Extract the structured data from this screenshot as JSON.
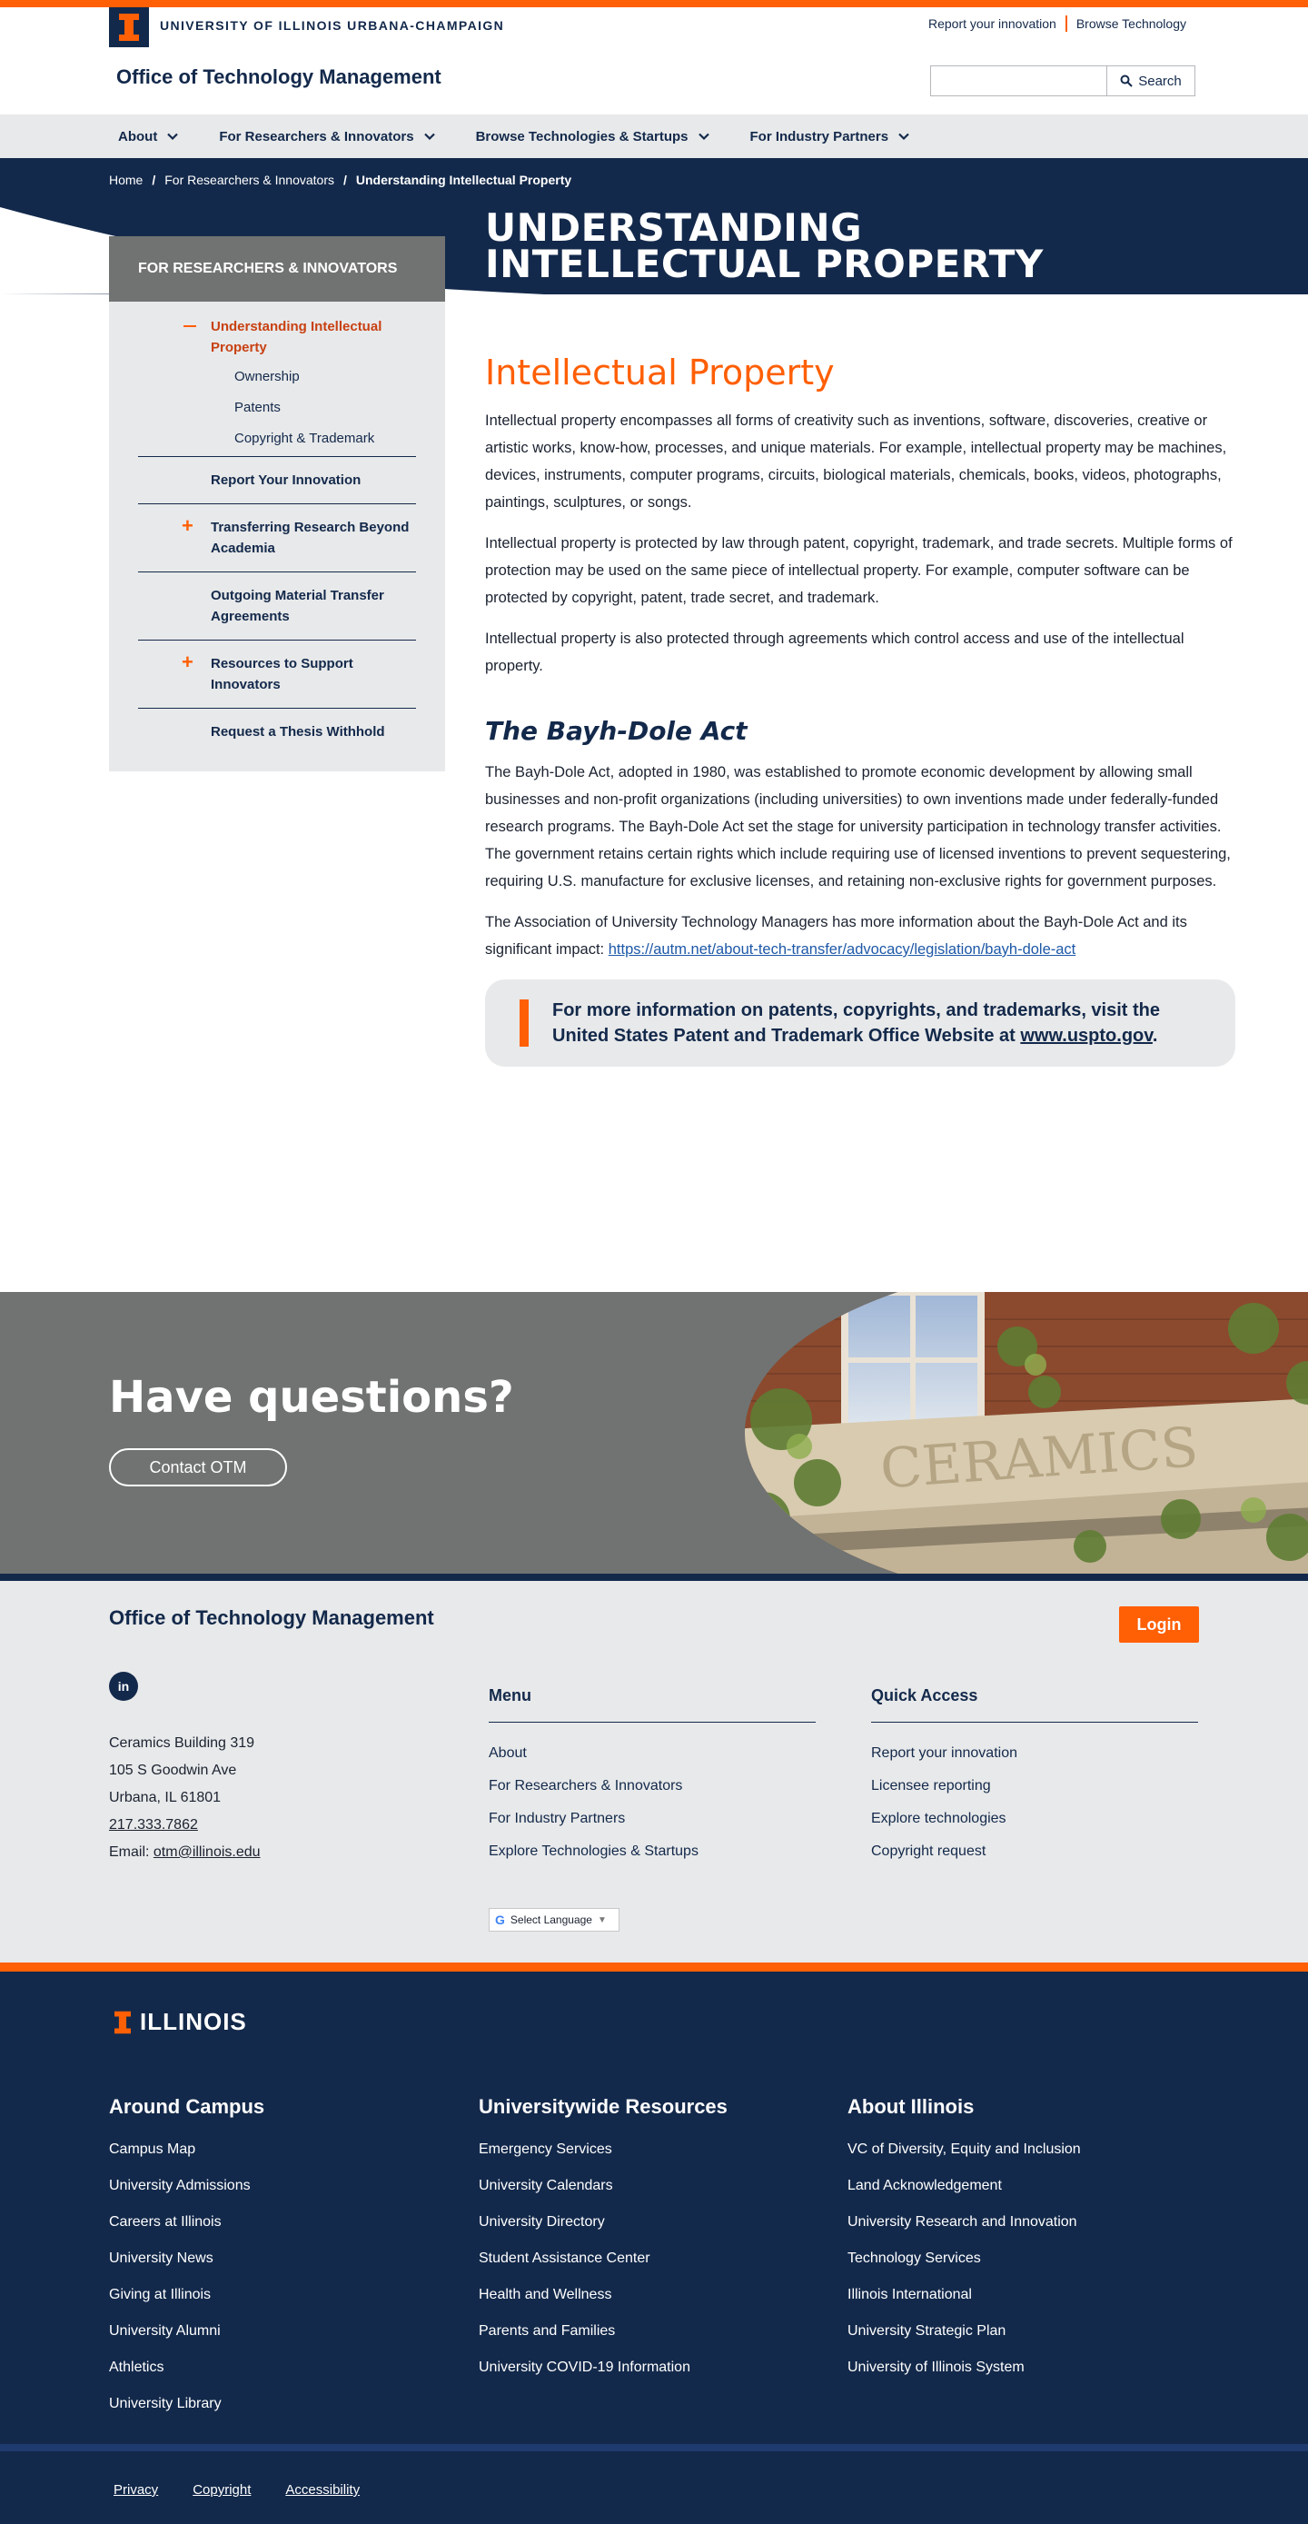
{
  "header": {
    "university": "UNIVERSITY OF ILLINOIS URBANA-CHAMPAIGN",
    "util_links": [
      "Report your innovation",
      "Browse Technology"
    ],
    "unit_title": "Office of Technology Management",
    "search_button": "Search"
  },
  "nav": {
    "items": [
      "About",
      "For Researchers & Innovators",
      "Browse Technologies & Startups",
      "For Industry Partners"
    ]
  },
  "breadcrumb": {
    "home": "Home",
    "parent": "For Researchers & Innovators",
    "current": "Understanding Intellectual Property"
  },
  "hero": {
    "title": "UNDERSTANDING INTELLECTUAL PROPERTY"
  },
  "sidebar": {
    "heading": "FOR RESEARCHERS & INNOVATORS",
    "active": "Understanding Intellectual Property",
    "subitems": [
      "Ownership",
      "Patents",
      "Copyright & Trademark"
    ],
    "items": [
      "Report Your Innovation",
      "Transferring Research Beyond Academia",
      "Outgoing Material Transfer Agreements",
      "Resources to Support Innovators",
      "Request a Thesis Withhold"
    ]
  },
  "content": {
    "heading1": "Intellectual Property",
    "p1": "Intellectual property encompasses all forms of creativity such as inventions, software, discoveries, creative or artistic works, know-how, processes, and unique materials. For example, intellectual property may be machines, devices, instruments, computer programs, circuits, biological materials, chemicals, books, videos, photographs, paintings, sculptures, or songs.",
    "p2": "Intellectual property is protected by law through patent, copyright, trademark, and trade secrets. Multiple forms of protection may be used on the same piece of intellectual property. For example, computer software can be protected by copyright, patent, trade secret, and trademark.",
    "p3": "Intellectual property is also protected through agreements which control access and use of the intellectual property.",
    "heading2": "The Bayh-Dole Act",
    "p4": "The Bayh-Dole Act, adopted in 1980, was established to promote economic development by allowing small businesses and non-profit organizations (including universities) to own inventions made under federally-funded research programs. The Bayh-Dole Act set the stage for university participation in technology transfer activities. The government retains certain rights which include requiring use of licensed inventions to prevent sequestering, requiring U.S. manufacture for exclusive licenses, and retaining non-exclusive rights for government purposes.",
    "p5_text": "The Association of University Technology Managers has more information about the Bayh-Dole Act and its significant impact: ",
    "p5_link": "https://autm.net/about-tech-transfer/advocacy/legislation/bayh-dole-act",
    "callout_text": "For more information on patents, copyrights, and trademarks, visit the United States Patent and Trademark Office Website at ",
    "callout_link": "www.uspto.gov",
    "callout_end": "."
  },
  "questions": {
    "title": "Have questions?",
    "button": "Contact OTM"
  },
  "footer": {
    "title": "Office of Technology Management",
    "login": "Login",
    "linkedin": "in",
    "address": [
      "Ceramics Building 319",
      "105 S Goodwin Ave",
      "Urbana, IL 61801"
    ],
    "phone": "217.333.7862",
    "email_label": "Email: ",
    "email": "otm@illinois.edu",
    "menu_heading": "Menu",
    "menu": [
      "About",
      "For Researchers & Innovators",
      "For Industry Partners",
      "Explore Technologies & Startups"
    ],
    "quick_heading": "Quick Access",
    "quick": [
      "Report your innovation",
      "Licensee reporting",
      "Explore technologies",
      "Copyright request"
    ],
    "translate": "Select Language"
  },
  "dark_footer": {
    "logo": "ILLINOIS",
    "col1_heading": "Around Campus",
    "col1": [
      "Campus Map",
      "University Admissions",
      "Careers at Illinois",
      "University News",
      "Giving at Illinois",
      "University Alumni",
      "Athletics",
      "University Library"
    ],
    "col2_heading": "Universitywide Resources",
    "col2": [
      "Emergency Services",
      "University Calendars",
      "University Directory",
      "Student Assistance Center",
      "Health and Wellness",
      "Parents and Families",
      "University COVID-19 Information"
    ],
    "col3_heading": "About Illinois",
    "col3": [
      "VC of Diversity, Equity and Inclusion",
      "Land Acknowledgement",
      "University Research and Innovation",
      "Technology Services",
      "Illinois International",
      "University Strategic Plan",
      "University of Illinois System"
    ],
    "legal": [
      "Privacy",
      "Copyright",
      "Accessibility"
    ]
  },
  "colors": {
    "orange": "#ff5f05",
    "navy": "#13294b",
    "gray": "#707372",
    "light": "#e8e9ea"
  }
}
